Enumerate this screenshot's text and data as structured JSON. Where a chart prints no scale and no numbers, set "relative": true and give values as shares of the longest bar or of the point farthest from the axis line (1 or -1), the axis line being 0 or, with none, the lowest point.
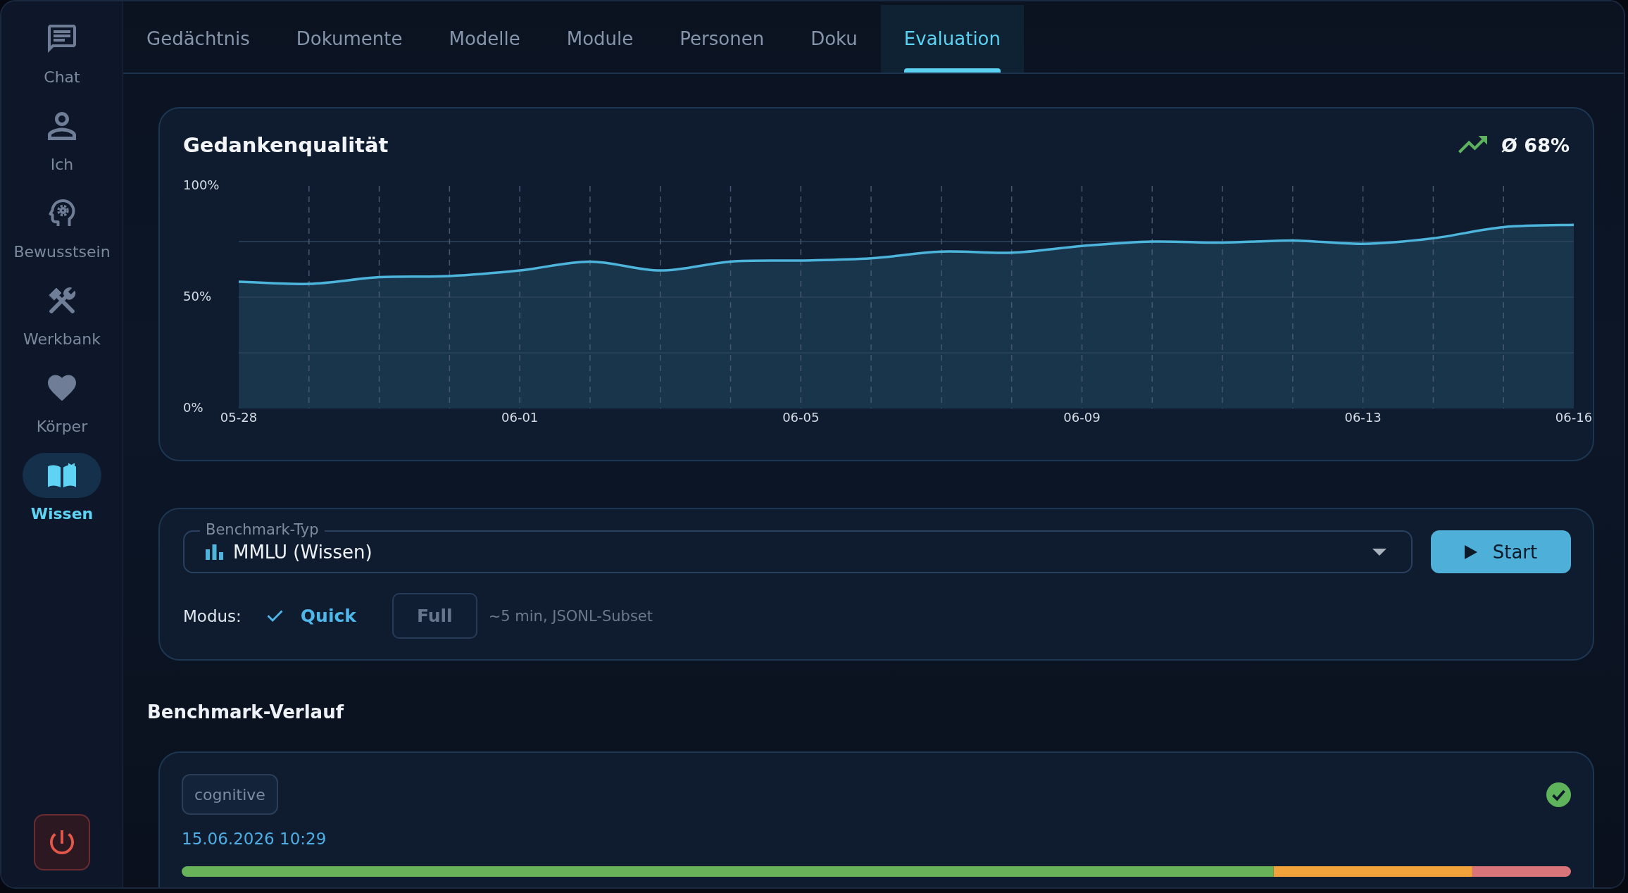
{
  "sidebar": {
    "items": [
      {
        "label": "Chat",
        "selected": false
      },
      {
        "label": "Ich",
        "selected": false
      },
      {
        "label": "Bewusstsein",
        "selected": false
      },
      {
        "label": "Werkbank",
        "selected": false
      },
      {
        "label": "Körper",
        "selected": false
      },
      {
        "label": "Wissen",
        "selected": true
      }
    ]
  },
  "tabs": [
    {
      "label": "Gedächtnis",
      "selected": false
    },
    {
      "label": "Dokumente",
      "selected": false
    },
    {
      "label": "Modelle",
      "selected": false
    },
    {
      "label": "Module",
      "selected": false
    },
    {
      "label": "Personen",
      "selected": false
    },
    {
      "label": "Doku",
      "selected": false
    },
    {
      "label": "Evaluation",
      "selected": true
    }
  ],
  "quality_card": {
    "average": "Ø 68%",
    "chart_data": {
      "type": "area",
      "title": "Gedankenqualität",
      "grid": true,
      "categories": [
        "05-28",
        null,
        null,
        null,
        "06-01",
        null,
        null,
        null,
        "06-05",
        null,
        null,
        null,
        "06-09",
        null,
        null,
        null,
        "06-13",
        null,
        null,
        "06-16"
      ],
      "ylim": [
        0,
        100
      ],
      "yticks": [
        {
          "value": 0,
          "label": "0%"
        },
        {
          "value": 25,
          "label": null
        },
        {
          "value": 50,
          "label": "50%"
        },
        {
          "value": 75,
          "label": null
        },
        {
          "value": 100,
          "label": "100%"
        }
      ],
      "series": [
        {
          "color": "#4db4dc",
          "values": [
            57,
            56,
            59,
            59.5,
            62,
            66,
            62,
            66,
            66.5,
            67.5,
            70.5,
            70,
            73,
            75,
            74.5,
            75.5,
            74,
            76.5,
            81.5,
            82.5
          ]
        }
      ]
    }
  },
  "benchmark_form": {
    "type_field": {
      "label": "Benchmark-Typ",
      "value": "MMLU (Wissen)"
    },
    "start_button": "Start",
    "mode_label": "Modus:",
    "modes": [
      {
        "label": "Quick",
        "selected": true
      },
      {
        "label": "Full",
        "selected": false
      }
    ],
    "mode_hint": "~5 min, JSONL-Subset"
  },
  "history": {
    "title": "Benchmark-Verlauf",
    "runs": [
      {
        "tag": "cognitive",
        "timestamp": "15.06.2026 10:29",
        "chart_data": {
          "type": "bar",
          "orientation": "horizontal",
          "stacked": true,
          "relative": true,
          "series": [
            {
              "color": "#68b35a",
              "values": [
                0.786
              ]
            },
            {
              "color": "#f2a23a",
              "values": [
                0.143
              ]
            },
            {
              "color": "#d9747a",
              "values": [
                0.071
              ]
            }
          ]
        }
      }
    ]
  }
}
